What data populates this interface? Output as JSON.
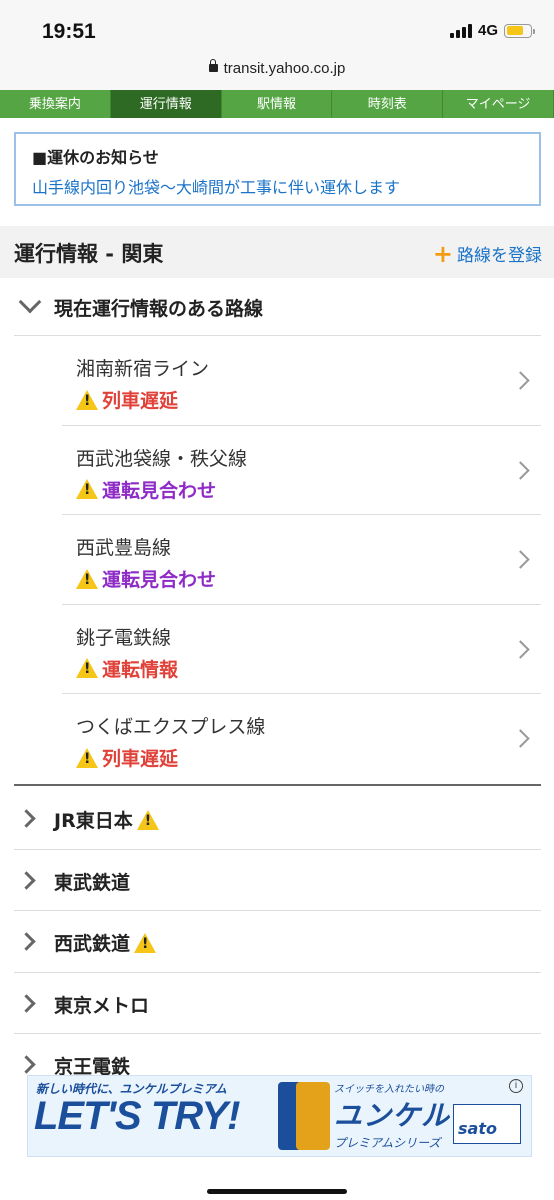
{
  "status_bar": {
    "time": "19:51",
    "network": "4G"
  },
  "browser": {
    "url": "transit.yahoo.co.jp"
  },
  "tabs": [
    {
      "label": "乗換案内",
      "active": false
    },
    {
      "label": "運行情報",
      "active": true
    },
    {
      "label": "駅情報",
      "active": false
    },
    {
      "label": "時刻表",
      "active": false
    },
    {
      "label": "マイページ",
      "active": false
    }
  ],
  "notice": {
    "title": "■運休のお知らせ",
    "link": "山手線内回り池袋〜大崎間が工事に伴い運休します"
  },
  "section": {
    "title": "運行情報 - 関東",
    "register_label": "路線を登録"
  },
  "current": {
    "title": "現在運行情報のある路線",
    "lines": [
      {
        "name": "湘南新宿ライン",
        "status": "列車遅延",
        "color": "#e0423a"
      },
      {
        "name": "西武池袋線・秩父線",
        "status": "運転見合わせ",
        "color": "#8e2bc7"
      },
      {
        "name": "西武豊島線",
        "status": "運転見合わせ",
        "color": "#8e2bc7"
      },
      {
        "name": "銚子電鉄線",
        "status": "運転情報",
        "color": "#e0423a"
      },
      {
        "name": "つくばエクスプレス線",
        "status": "列車遅延",
        "color": "#e0423a"
      }
    ]
  },
  "companies": [
    {
      "name": "JR東日本",
      "warning": true
    },
    {
      "name": "東武鉄道",
      "warning": false
    },
    {
      "name": "西武鉄道",
      "warning": true
    },
    {
      "name": "東京メトロ",
      "warning": false
    },
    {
      "name": "京王電鉄",
      "warning": false
    }
  ],
  "ad": {
    "tagline": "新しい時代に、ユンケルプレミアム",
    "headline": "LET'S TRY!",
    "subtag": "スイッチを入れたい時の",
    "brand": "ユンケル",
    "series": "プレミアムシリーズ",
    "company": "sato"
  }
}
